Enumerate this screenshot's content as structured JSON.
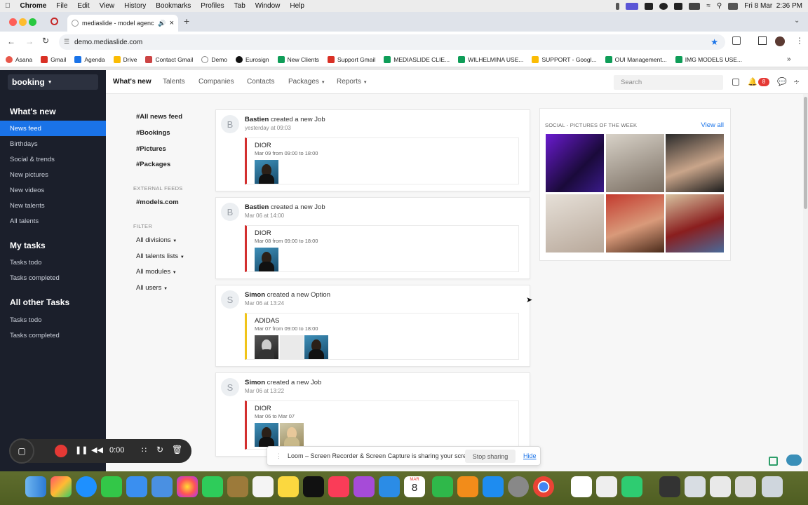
{
  "menubar": {
    "app": "Chrome",
    "items": [
      "File",
      "Edit",
      "View",
      "History",
      "Bookmarks",
      "Profiles",
      "Tab",
      "Window",
      "Help"
    ],
    "clock": "Fri 8 Mar  2:36 PM"
  },
  "browser": {
    "tab_title": "mediaslide - model agenc",
    "url": "demo.mediaslide.com",
    "bookmarks": [
      "Asana",
      "Gmail",
      "Agenda",
      "Drive",
      "Contact Gmail",
      "Demo",
      "Eurosign",
      "New Clients",
      "Support Gmail",
      "MEDIASLIDE CLIE...",
      "WILHELMINA USE...",
      "SUPPORT - Googl...",
      "OUI Management...",
      "IMG MODELS USE..."
    ],
    "bookmark_colors": [
      "#e8574a",
      "#d93025",
      "#1a73e8",
      "#fbbc04",
      "#c44",
      "#333",
      "#111",
      "#0f9d58",
      "#d93025",
      "#0f9d58",
      "#0f9d58",
      "#fbbc04",
      "#0f9d58",
      "#0f9d58"
    ]
  },
  "sidebar": {
    "switcher": "booking",
    "sections": [
      {
        "title": "What's new",
        "items": [
          "News feed",
          "Birthdays",
          "Social & trends",
          "New pictures",
          "New videos",
          "New talents",
          "All talents"
        ]
      },
      {
        "title": "My tasks",
        "items": [
          "Tasks todo",
          "Tasks completed"
        ]
      },
      {
        "title": "All other Tasks",
        "items": [
          "Tasks todo",
          "Tasks completed"
        ]
      }
    ]
  },
  "nav": {
    "items": [
      "What's new",
      "Talents",
      "Companies",
      "Contacts",
      "Packages",
      "Reports"
    ],
    "search_placeholder": "Search",
    "notif_count": "8"
  },
  "feeds": {
    "links": [
      "#All news feed",
      "#Bookings",
      "#Pictures",
      "#Packages"
    ],
    "external_label": "EXTERNAL FEEDS",
    "external": [
      "#models.com"
    ],
    "filter_label": "FILTER",
    "filters": [
      "All divisions",
      "All talents lists",
      "All modules",
      "All users"
    ]
  },
  "cards": [
    {
      "initial": "B",
      "user": "Bastien",
      "action": "created a new Job",
      "date": "yesterday at 09:03",
      "client": "DIOR",
      "period": "Mar 09 from 09:00 to 18:00",
      "color": "#d32f2f"
    },
    {
      "initial": "B",
      "user": "Bastien",
      "action": "created a new Job",
      "date": "Mar 06 at 14:00",
      "client": "DIOR",
      "period": "Mar 08 from 09:00 to 18:00",
      "color": "#d32f2f"
    },
    {
      "initial": "S",
      "user": "Simon",
      "action": "created a new Option",
      "date": "Mar 06 at 13:24",
      "client": "ADIDAS",
      "period": "Mar 07 from 09:00 to 18:00",
      "color": "#f0c419"
    },
    {
      "initial": "S",
      "user": "Simon",
      "action": "created a new Job",
      "date": "Mar 06 at 13:22",
      "client": "DIOR",
      "period": "Mar 06 to Mar 07",
      "color": "#d32f2f"
    }
  ],
  "social": {
    "title": "SOCIAL - PICTURES OF THE WEEK",
    "view_all": "View all"
  },
  "recorder": {
    "time": "0:00"
  },
  "loom": {
    "message": "Loom – Screen Recorder & Screen Capture is sharing your screen.",
    "stop": "Stop sharing",
    "hide": "Hide"
  },
  "dock": {
    "calendar_month": "MAR",
    "calendar_day": "8"
  }
}
